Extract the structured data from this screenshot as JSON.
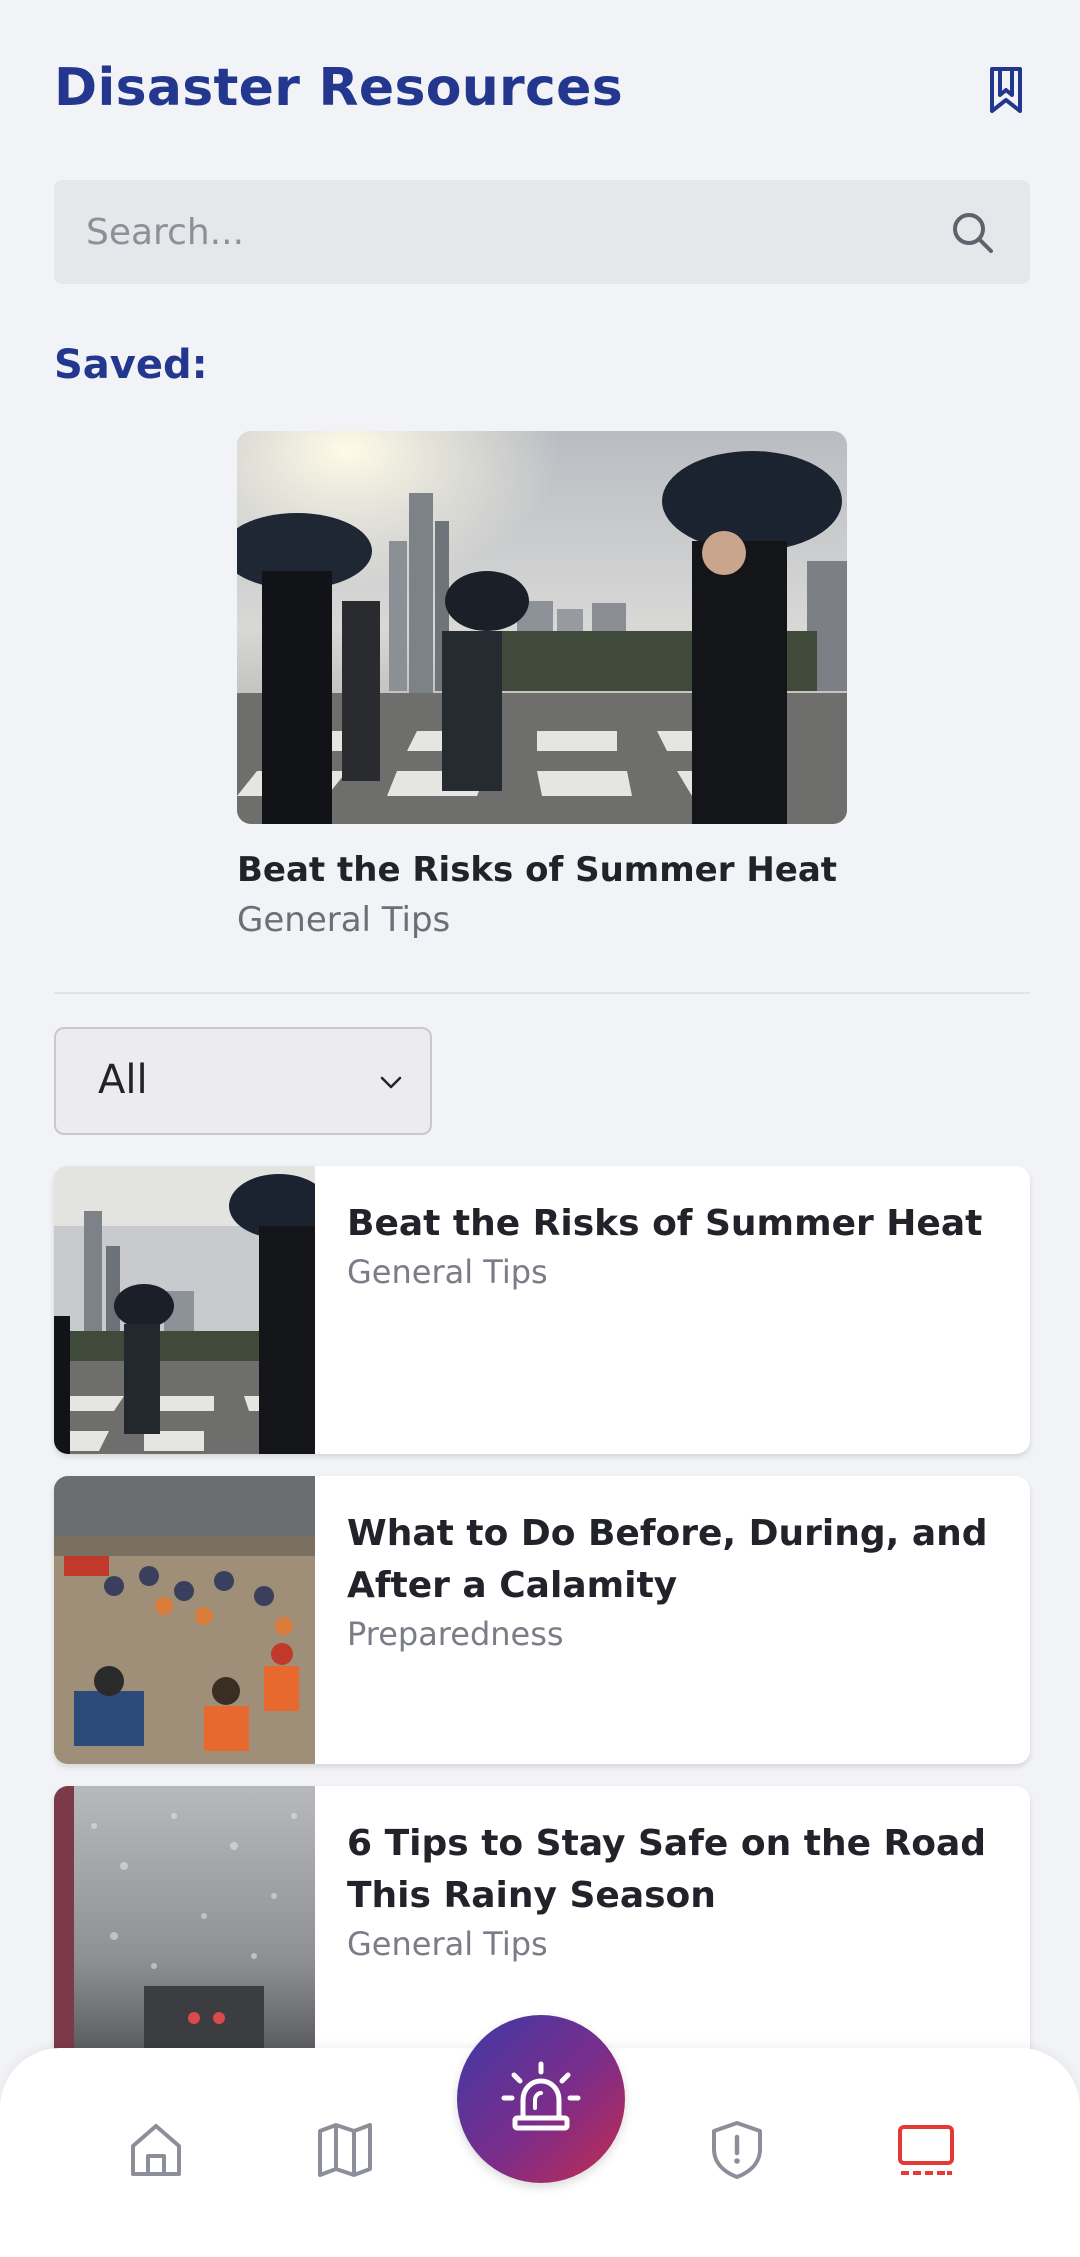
{
  "header": {
    "title": "Disaster Resources",
    "bookmark_icon": "bookmark-icon"
  },
  "search": {
    "placeholder": "Search...",
    "value": "",
    "icon": "search-icon"
  },
  "saved": {
    "label": "Saved:",
    "items": [
      {
        "title": "Beat the Risks of Summer Heat",
        "category": "General Tips",
        "image": "people-with-umbrellas-crosswalk-photo"
      }
    ]
  },
  "filter": {
    "selected": "All",
    "icon": "chevron-down-icon"
  },
  "articles": [
    {
      "title": "Beat the Risks of Summer Heat",
      "category": "General Tips",
      "image": "people-with-umbrellas-crosswalk-photo"
    },
    {
      "title": "What to Do Before, During, and After a Calamity",
      "category": "Preparedness",
      "image": "flood-rescue-photo"
    },
    {
      "title": "6 Tips to Stay Safe on the Road This Rainy Season",
      "category": "General Tips",
      "image": "rainy-windshield-photo"
    }
  ],
  "nav": {
    "items": [
      {
        "icon": "home-icon",
        "active": false
      },
      {
        "icon": "map-icon",
        "active": false
      },
      {
        "icon": "emergency-siren-icon",
        "active": false
      },
      {
        "icon": "shield-alert-icon",
        "active": false
      },
      {
        "icon": "resources-icon",
        "active": true
      }
    ],
    "colors": {
      "active": "#e53935",
      "inactive": "#8c8f99",
      "brand": "#23378e"
    }
  }
}
